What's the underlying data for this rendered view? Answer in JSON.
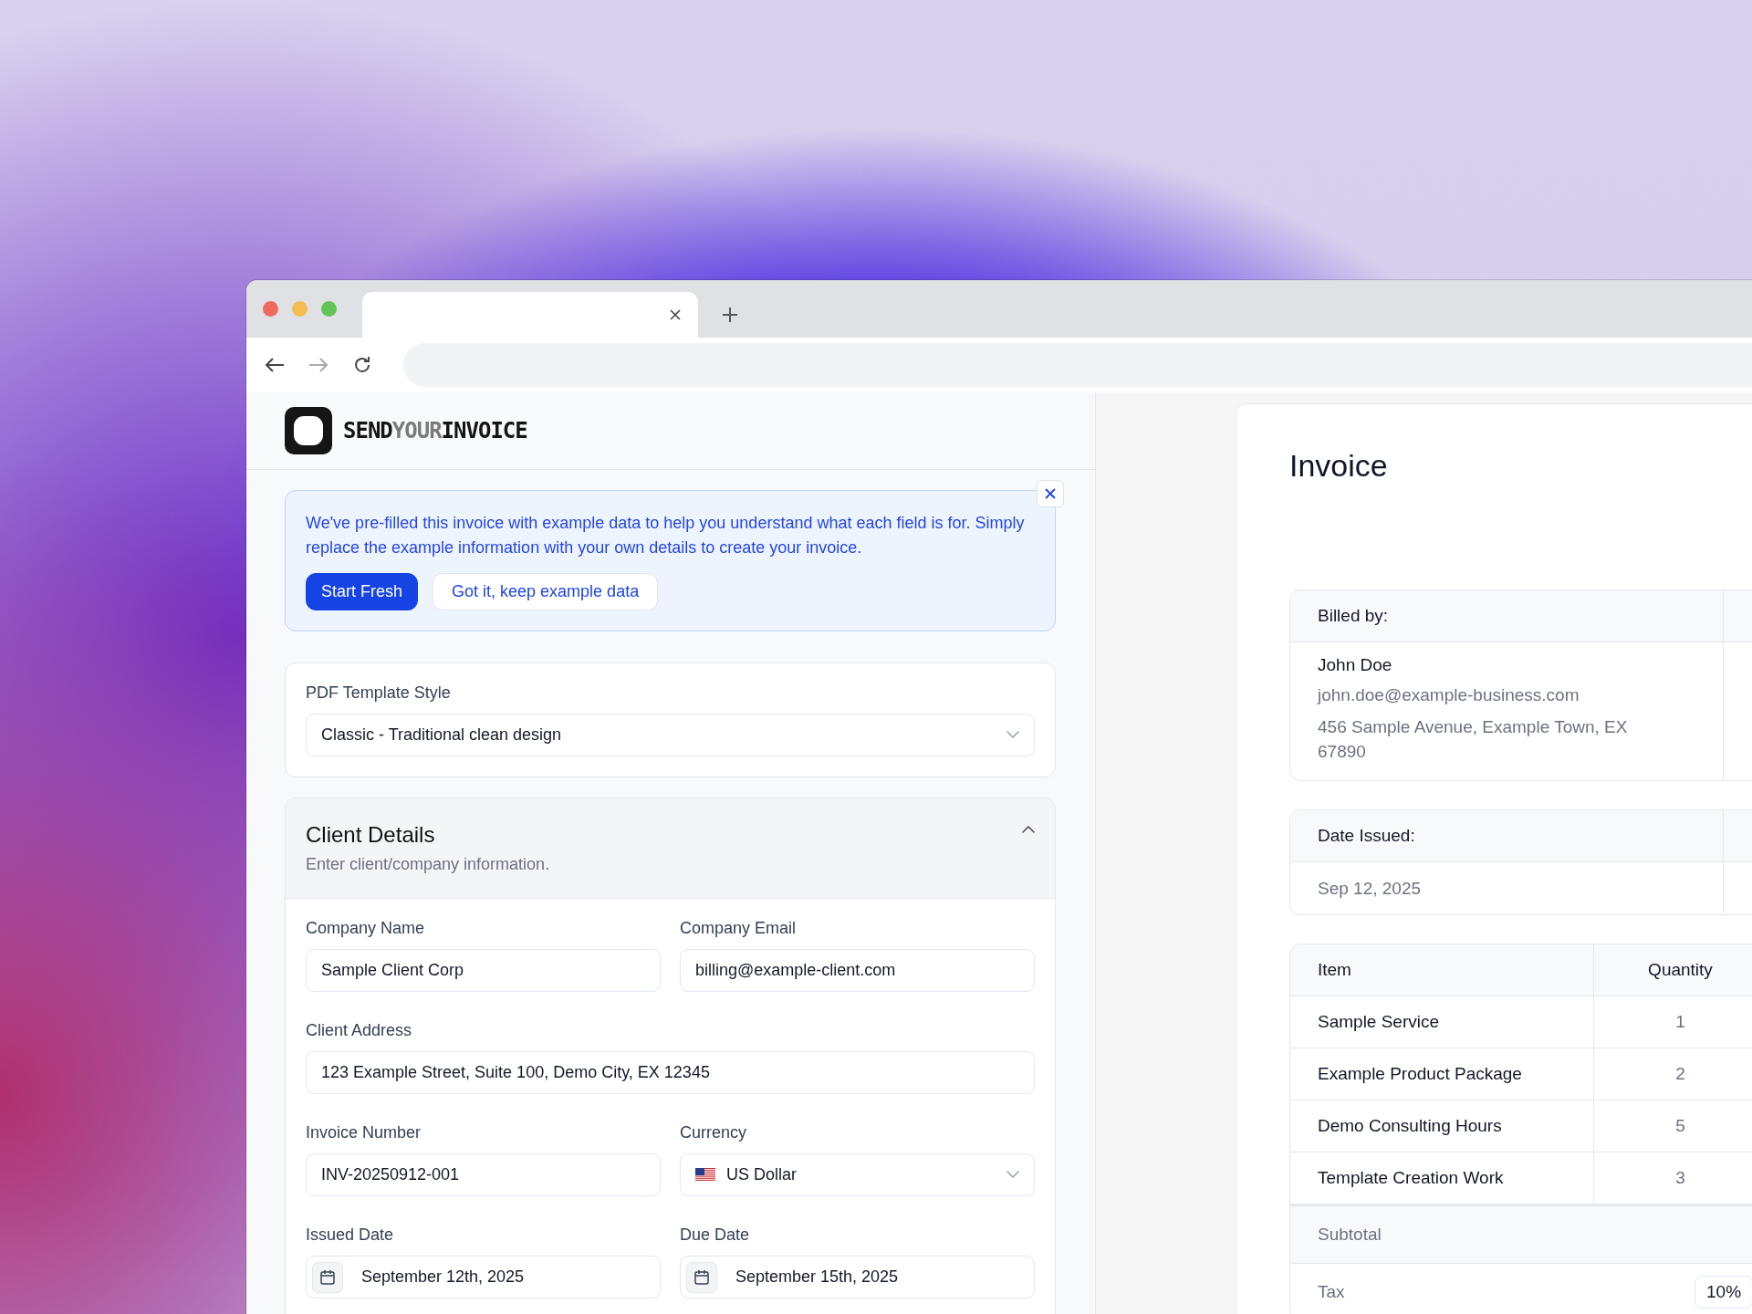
{
  "app": {
    "brand": [
      {
        "text": "SEND",
        "kind": "strong"
      },
      {
        "text": "YOUR",
        "kind": "muted"
      },
      {
        "text": "INVOICE",
        "kind": "strong"
      }
    ],
    "notice": {
      "message": "We've pre-filled this invoice with example data to help you understand what each field is for. Simply replace the example information with your own details to create your invoice.",
      "buttons": [
        {
          "label": "Start Fresh",
          "kind": "primary"
        },
        {
          "label": "Got it, keep example data",
          "kind": "secondary"
        }
      ]
    },
    "template": {
      "label": "PDF Template Style",
      "value": "Classic - Traditional clean design"
    },
    "client_details": {
      "title": "Client Details",
      "subtitle": "Enter client/company information.",
      "expanded": true,
      "fields": [
        {
          "label": "Company Name",
          "value": "Sample Client Corp",
          "kind": "text"
        },
        {
          "label": "Company Email",
          "value": "billing@example-client.com",
          "kind": "text"
        },
        {
          "label": "Client Address",
          "value": "123 Example Street, Suite 100, Demo City, EX 12345",
          "kind": "wide"
        },
        {
          "label": "Invoice Number",
          "value": "INV-20250912-001",
          "kind": "text"
        },
        {
          "label": "Currency",
          "value": "US Dollar",
          "kind": "currency"
        },
        {
          "label": "Issued Date",
          "value": "September 12th, 2025",
          "kind": "date"
        },
        {
          "label": "Due Date",
          "value": "September 15th, 2025",
          "kind": "date"
        }
      ]
    }
  },
  "invoice_preview": {
    "title": "Invoice",
    "billed_by": {
      "heading": "Billed by:",
      "name": "John Doe",
      "email": "john.doe@example-business.com",
      "address": "456 Sample Avenue, Example Town, EX 67890"
    },
    "date_issued": {
      "heading": "Date Issued:",
      "value": "Sep 12, 2025"
    },
    "items": {
      "columns": [
        "Item",
        "Quantity"
      ],
      "rows": [
        {
          "item": "Sample Service",
          "quantity": "1"
        },
        {
          "item": "Example Product Package",
          "quantity": "2"
        },
        {
          "item": "Demo Consulting Hours",
          "quantity": "5"
        },
        {
          "item": "Template Creation Work",
          "quantity": "3"
        }
      ]
    },
    "subtotal_label": "Subtotal",
    "tax": {
      "label": "Tax",
      "rate": "10%"
    }
  }
}
